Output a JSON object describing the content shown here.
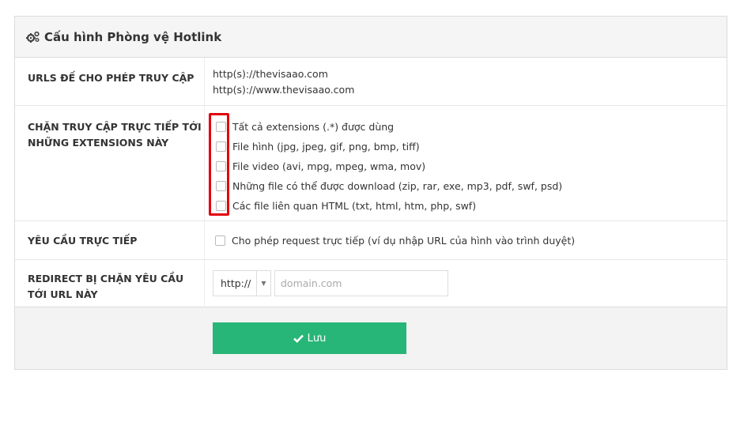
{
  "panel": {
    "title": "Cấu hình Phòng vệ Hotlink",
    "title_icon": "gears-icon"
  },
  "urls_row": {
    "label": "URLS ĐẾ CHO PHÉP TRUY CẬP",
    "values": [
      "http(s)://thevisaao.com",
      "http(s)://www.thevisaao.com"
    ]
  },
  "ext_row": {
    "label": "CHẶN TRUY CẬP TRỰC TIẾP TỚI NHỮNG EXTENSIONS NÀY",
    "options": [
      "Tất cả extensions (.*) được dùng",
      "File hình (jpg, jpeg, gif, png, bmp, tiff)",
      "File video (avi, mpg, mpeg, wma, mov)",
      "Những file có thể được download (zip, rar, exe, mp3, pdf, swf, psd)",
      "Các file liên quan HTML (txt, html, htm, php, swf)"
    ],
    "highlight_color": "#e3000b"
  },
  "direct_row": {
    "label": "YÊU CẦU TRỰC TIẾP",
    "option": "Cho phép request trực tiếp (ví dụ nhập URL của hình vào trình duyệt)"
  },
  "redirect_row": {
    "label": "REDIRECT BỊ CHẶN YÊU CẦU TỚI URL NÀY",
    "protocol": "http://",
    "domain_placeholder": "domain.com",
    "domain_value": ""
  },
  "footer": {
    "save_label": "Lưu",
    "save_color": "#27b678"
  }
}
